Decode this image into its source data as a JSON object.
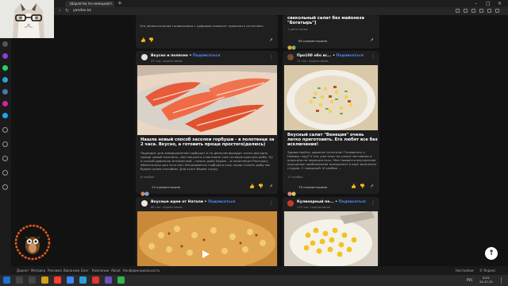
{
  "browser": {
    "tab_title": "Шарлотка по-немецкой",
    "url": "yandex.kz"
  },
  "feed": {
    "top_left_snippet": "Эта увлекательная головоломка с цифрами поможет прокачать интеллект.",
    "top_right_title": "свекольный салат без майонеза \"Богатырь\"]",
    "top_right_date": "1 день назад",
    "top_right_comments": "80 комментариев",
    "cards": [
      {
        "author": "Вкусно и полезно",
        "subscribe": "Подписаться",
        "meta": "53 тыс. подписчиков",
        "title": "Нашла новый способ засолки горбуши - в полотенце за 2 часа. Вкусно, а готовить проще простого(делюсь)",
        "snippet": "Подходит для замороженной горбуши! А по деньгам выходит очень выгодно проще самой засолить, чем покупать в магазине уже готовую красную рыбу. Ну и способ довольно интересный - солить рыбу будем ...в полотенце! Расскажу обязательно для чего оно. Ингредиенты горбушка соль сахар Солить рыбу мы будем сухим способом. Для этого берем тушку",
        "date": "8 ноября",
        "comments": "15 комментариев"
      },
      {
        "author": "Про100 обо вс...",
        "subscribe": "Подписаться",
        "meta": "11 тыс. подписчиков",
        "title": "Вкусный салат \"Венеция\" очень легко приготовить. Его любят все без исключения!",
        "snippet": "Здравствуйте, дорогие читатели! Готовитесь к Новому году? У нас уже плач на улице поставили и украсили на перекрестках. Мне нравится внутреннее ощущение приближения праздника! А ещё заполнить студию. С горошкой. И хлебом ...",
        "date": "13 ноября",
        "comments": "79 комментариев"
      },
      {
        "author": "Вкусные идеи от Натали",
        "subscribe": "Подписаться",
        "meta": "66 тыс. подписчиков"
      },
      {
        "author": "Кулинарный пе...",
        "subscribe": "Подписаться",
        "meta": "119 тыс. подписчиков"
      }
    ]
  },
  "yandex_bar": {
    "links": [
      "Директ",
      "Метрика",
      "Реклама",
      "Вакансии",
      "Блог",
      "Компании",
      "About",
      "Конфиденциальность"
    ],
    "settings": "Настройки",
    "copyright": "© Яндекс"
  },
  "taskbar": {
    "lang": "РУС",
    "time": "8:22",
    "date": "24.11.21"
  },
  "colors": {
    "accent": "#4d8dff",
    "card_bg": "#1f1f1f",
    "page_bg": "#121212"
  }
}
